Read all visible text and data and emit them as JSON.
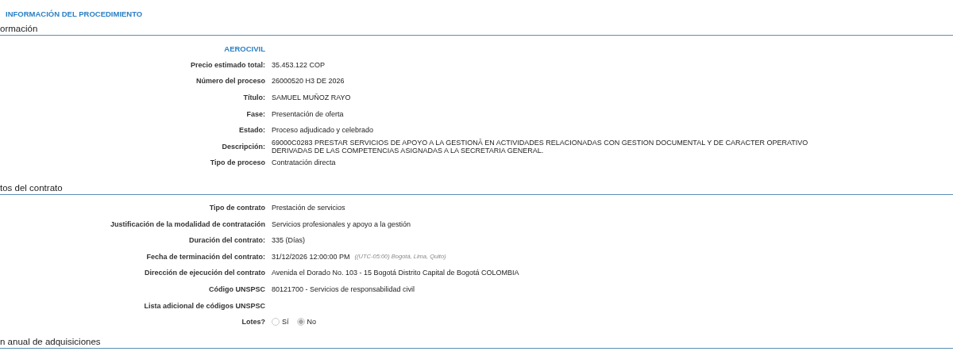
{
  "page_title": "INFORMACIÓN DEL PROCEDIMIENTO",
  "sections": [
    {
      "title": "ormación",
      "entity": "AEROCIVIL",
      "rows": [
        {
          "kind": "text",
          "label": "Precio estimado total:",
          "value": "35.453.122 COP"
        },
        {
          "kind": "text",
          "label": "Número del proceso",
          "value": "26000520 H3 DE 2026"
        },
        {
          "kind": "text",
          "label": "Título:",
          "value": "SAMUEL MUÑOZ RAYO"
        },
        {
          "kind": "text",
          "label": "Fase:",
          "value": "Presentación de oferta"
        },
        {
          "kind": "text",
          "label": "Estado:",
          "value": "Proceso adjudicado y celebrado"
        },
        {
          "kind": "text",
          "label": "Descripción:",
          "value": "69000C0283 PRESTAR SERVICIOS DE APOYO A LA GESTIONÂ EN ACTIVIDADES RELACIONADAS CON GESTION DOCUMENTAL Y DE CARACTER OPERATIVO DERIVADAS DE LAS COMPETENCIAS ASIGNADAS A LA SECRETARIA GENERAL."
        },
        {
          "kind": "text",
          "label": "Tipo de proceso",
          "value": "Contratación directa"
        }
      ]
    },
    {
      "title": "tos del contrato",
      "rows": [
        {
          "kind": "text",
          "label": "Tipo de contrato",
          "value": "Prestación de servicios"
        },
        {
          "kind": "text",
          "label": "Justificación de la modalidad de contratación",
          "value": "Servicios profesionales y apoyo a la gestión"
        },
        {
          "kind": "text",
          "label": "Duración del contrato:",
          "value": "335 (Días)"
        },
        {
          "kind": "text",
          "label": "Fecha de terminación del contrato:",
          "value": "31/12/2026 12:00:00 PM",
          "note": "((UTC-05:00) Bogotá, Lima, Quito)"
        },
        {
          "kind": "text",
          "label": "Dirección de ejecución del contrato",
          "value": "Avenida el Dorado No. 103 - 15 Bogotá Distrito Capital de Bogotá COLOMBIA"
        },
        {
          "kind": "text",
          "label": "Código UNSPSC",
          "value": "80121700 - Servicios de responsabilidad civil"
        },
        {
          "kind": "text",
          "label": "Lista adicional de códigos UNSPSC"
        },
        {
          "kind": "radio",
          "label": "Lotes?",
          "options": [
            {
              "label": "Sí",
              "selected": false
            },
            {
              "label": "No",
              "selected": true
            }
          ]
        }
      ]
    },
    {
      "title": "n anual de adquisiciones"
    }
  ]
}
